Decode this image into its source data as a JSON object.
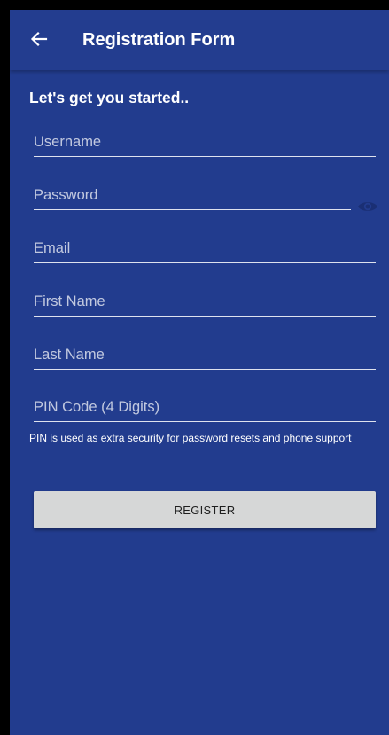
{
  "app_bar": {
    "title": "Registration Form",
    "back_icon": "arrow-left-icon"
  },
  "form": {
    "heading": "Let's get you started..",
    "fields": {
      "username": {
        "placeholder": "Username",
        "value": ""
      },
      "password": {
        "placeholder": "Password",
        "value": "",
        "toggle_icon": "eye-icon"
      },
      "email": {
        "placeholder": "Email",
        "value": ""
      },
      "first_name": {
        "placeholder": "First Name",
        "value": ""
      },
      "last_name": {
        "placeholder": "Last Name",
        "value": ""
      },
      "pin": {
        "placeholder": "PIN Code (4 Digits)",
        "value": ""
      }
    },
    "pin_helper": "PIN is used as extra security for password resets and phone support",
    "register_label": "REGISTER"
  },
  "colors": {
    "background": "#223c8e",
    "app_bar": "#233d8f",
    "text": "#ffffff",
    "button": "#d6d7d7",
    "eye_icon": "#1a2f74"
  }
}
